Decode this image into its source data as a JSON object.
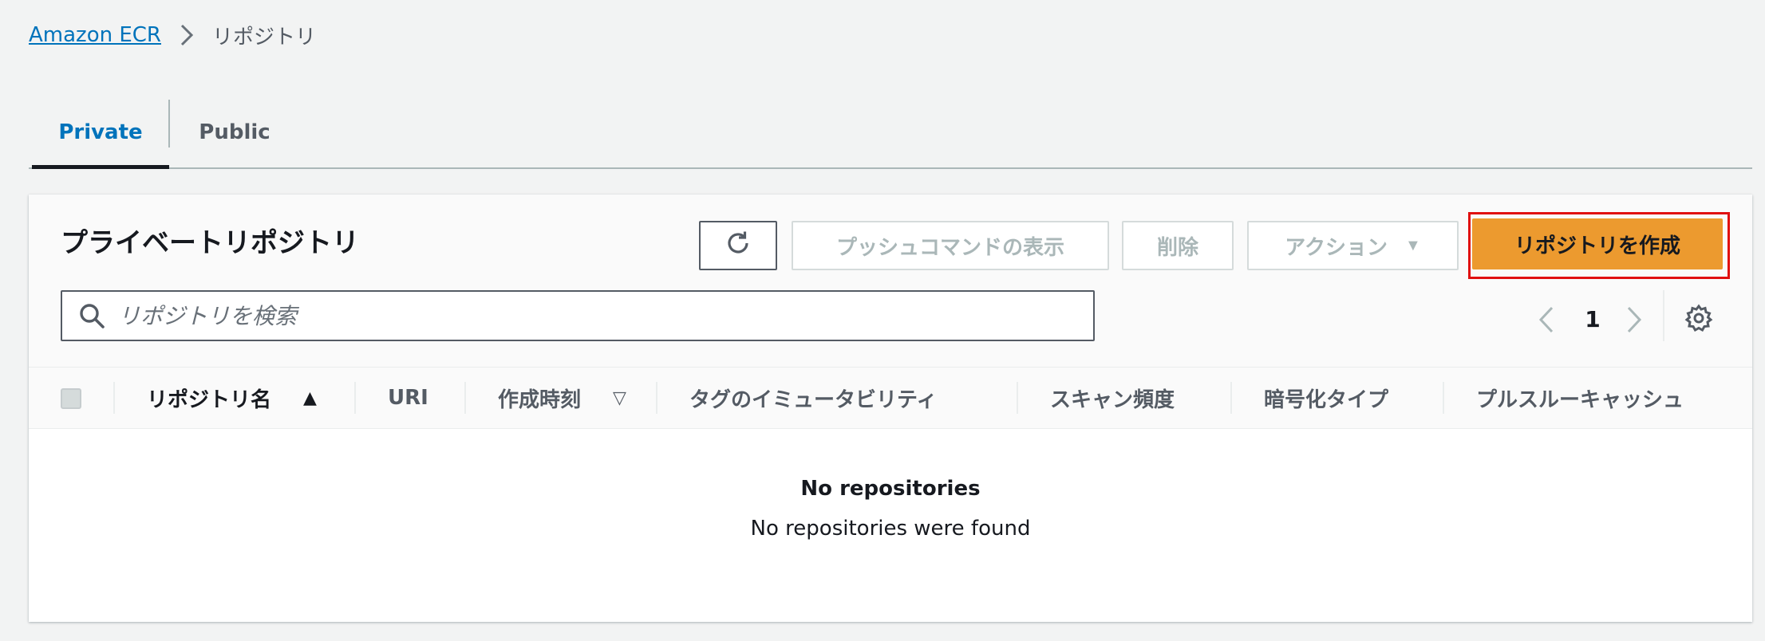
{
  "breadcrumb": {
    "root": "Amazon ECR",
    "current": "リポジトリ"
  },
  "tabs": [
    {
      "label": "Private",
      "active": true
    },
    {
      "label": "Public",
      "active": false
    }
  ],
  "panel": {
    "title": "プライベートリポジトリ",
    "buttons": {
      "refresh_icon": "refresh-icon",
      "push": "プッシュコマンドの表示",
      "delete": "削除",
      "action": "アクション",
      "create": "リポジトリを作成"
    },
    "search": {
      "placeholder": "リポジトリを検索",
      "value": ""
    },
    "pagination": {
      "current_page": "1"
    }
  },
  "table": {
    "columns": [
      "リポジトリ名",
      "URI",
      "作成時刻",
      "タグのイミュータビリティ",
      "スキャン頻度",
      "暗号化タイプ",
      "プルスルーキャッシュ"
    ],
    "sort_asc_glyph": "▲",
    "sort_desc_glyph": "▽",
    "empty_title": "No repositories",
    "empty_text": "No repositories were found"
  },
  "colors": {
    "accent_link": "#0073bb",
    "primary_button": "#ec9a2f",
    "highlight_box": "#e01010"
  }
}
